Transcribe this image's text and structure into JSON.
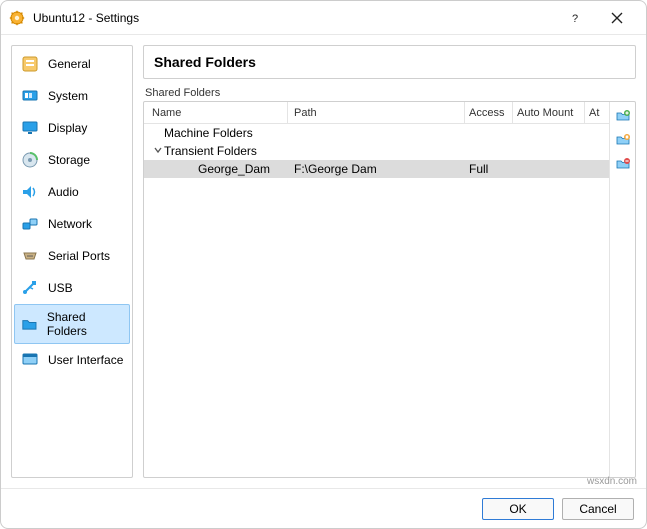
{
  "window": {
    "title": "Ubuntu12 - Settings"
  },
  "sidebar": {
    "items": [
      {
        "label": "General"
      },
      {
        "label": "System"
      },
      {
        "label": "Display"
      },
      {
        "label": "Storage"
      },
      {
        "label": "Audio"
      },
      {
        "label": "Network"
      },
      {
        "label": "Serial Ports"
      },
      {
        "label": "USB"
      },
      {
        "label": "Shared Folders"
      },
      {
        "label": "User Interface"
      }
    ]
  },
  "page": {
    "heading": "Shared Folders",
    "group_label": "Shared Folders",
    "columns": {
      "name": "Name",
      "path": "Path",
      "access": "Access",
      "auto_mount": "Auto Mount",
      "at": "At"
    },
    "tree": {
      "machine_folders_label": "Machine Folders",
      "transient_folders_label": "Transient Folders",
      "entries": [
        {
          "name": "George_Dam",
          "path": "F:\\George Dam",
          "access": "Full",
          "auto_mount": "",
          "at": ""
        }
      ]
    }
  },
  "buttons": {
    "ok": "OK",
    "cancel": "Cancel"
  },
  "watermark": "wsxdn.com"
}
